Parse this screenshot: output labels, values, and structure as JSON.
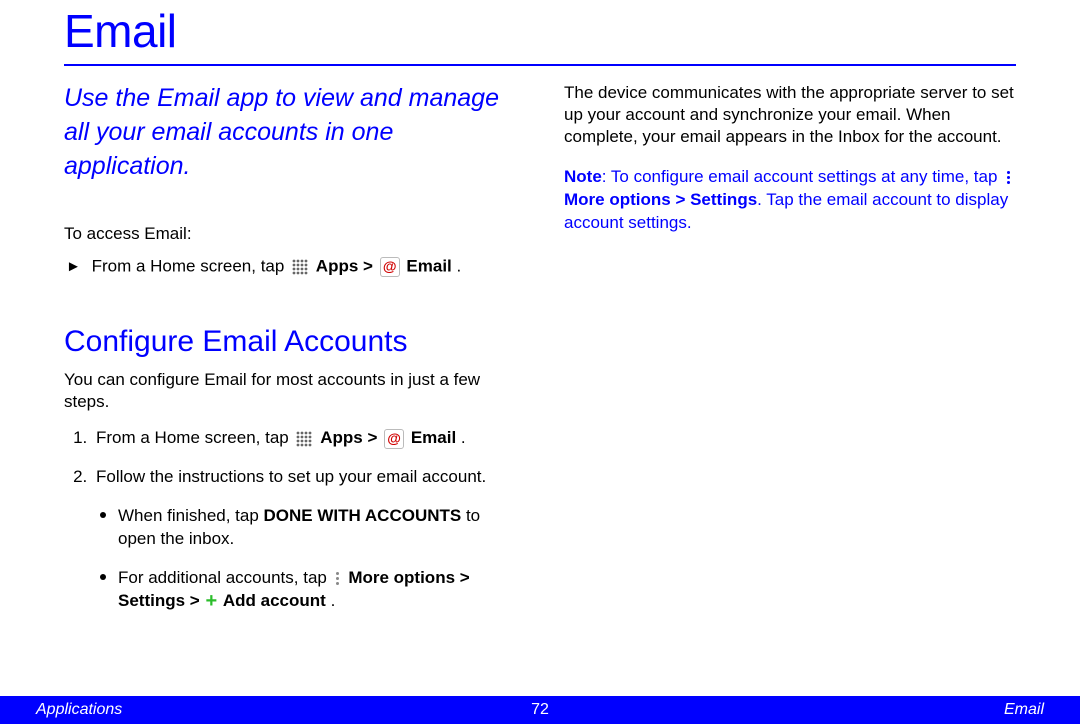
{
  "title": "Email",
  "intro": "Use the Email app to view and manage all your email accounts in one application.",
  "access_label": "To access Email:",
  "access_step": {
    "prefix": "From a Home screen, tap ",
    "apps_label": "Apps",
    "sep": " > ",
    "email_label": "Email",
    "suffix": "."
  },
  "section_heading": "Configure Email Accounts",
  "section_intro": "You can configure Email for most accounts in just a few steps.",
  "step1": {
    "prefix": "From a Home screen, tap ",
    "apps_label": "Apps",
    "sep": " > ",
    "email_label": "Email",
    "suffix": "."
  },
  "step2": "Follow the instructions to set up your email account.",
  "sub1": {
    "pre": "When finished, tap ",
    "bold": "DONE WITH ACCOUNTS",
    "post": " to open the inbox."
  },
  "sub2": {
    "pre": "For additional accounts, tap ",
    "more_label": "More options",
    "sep1": " > ",
    "settings_label": "Settings",
    "sep2": " > ",
    "add_label": "Add account",
    "suffix": "."
  },
  "right_para": "The device communicates with the appropriate server to set up your account and synchronize your email. When complete, your email appears in the Inbox for the account.",
  "note": {
    "label": "Note",
    "pre": ": To configure email account settings at any time, tap ",
    "more_label": "More options",
    "sep": " > ",
    "settings_label": "Settings",
    "post": ". Tap the email account to display account settings."
  },
  "footer": {
    "left": "Applications",
    "center": "72",
    "right": "Email"
  }
}
